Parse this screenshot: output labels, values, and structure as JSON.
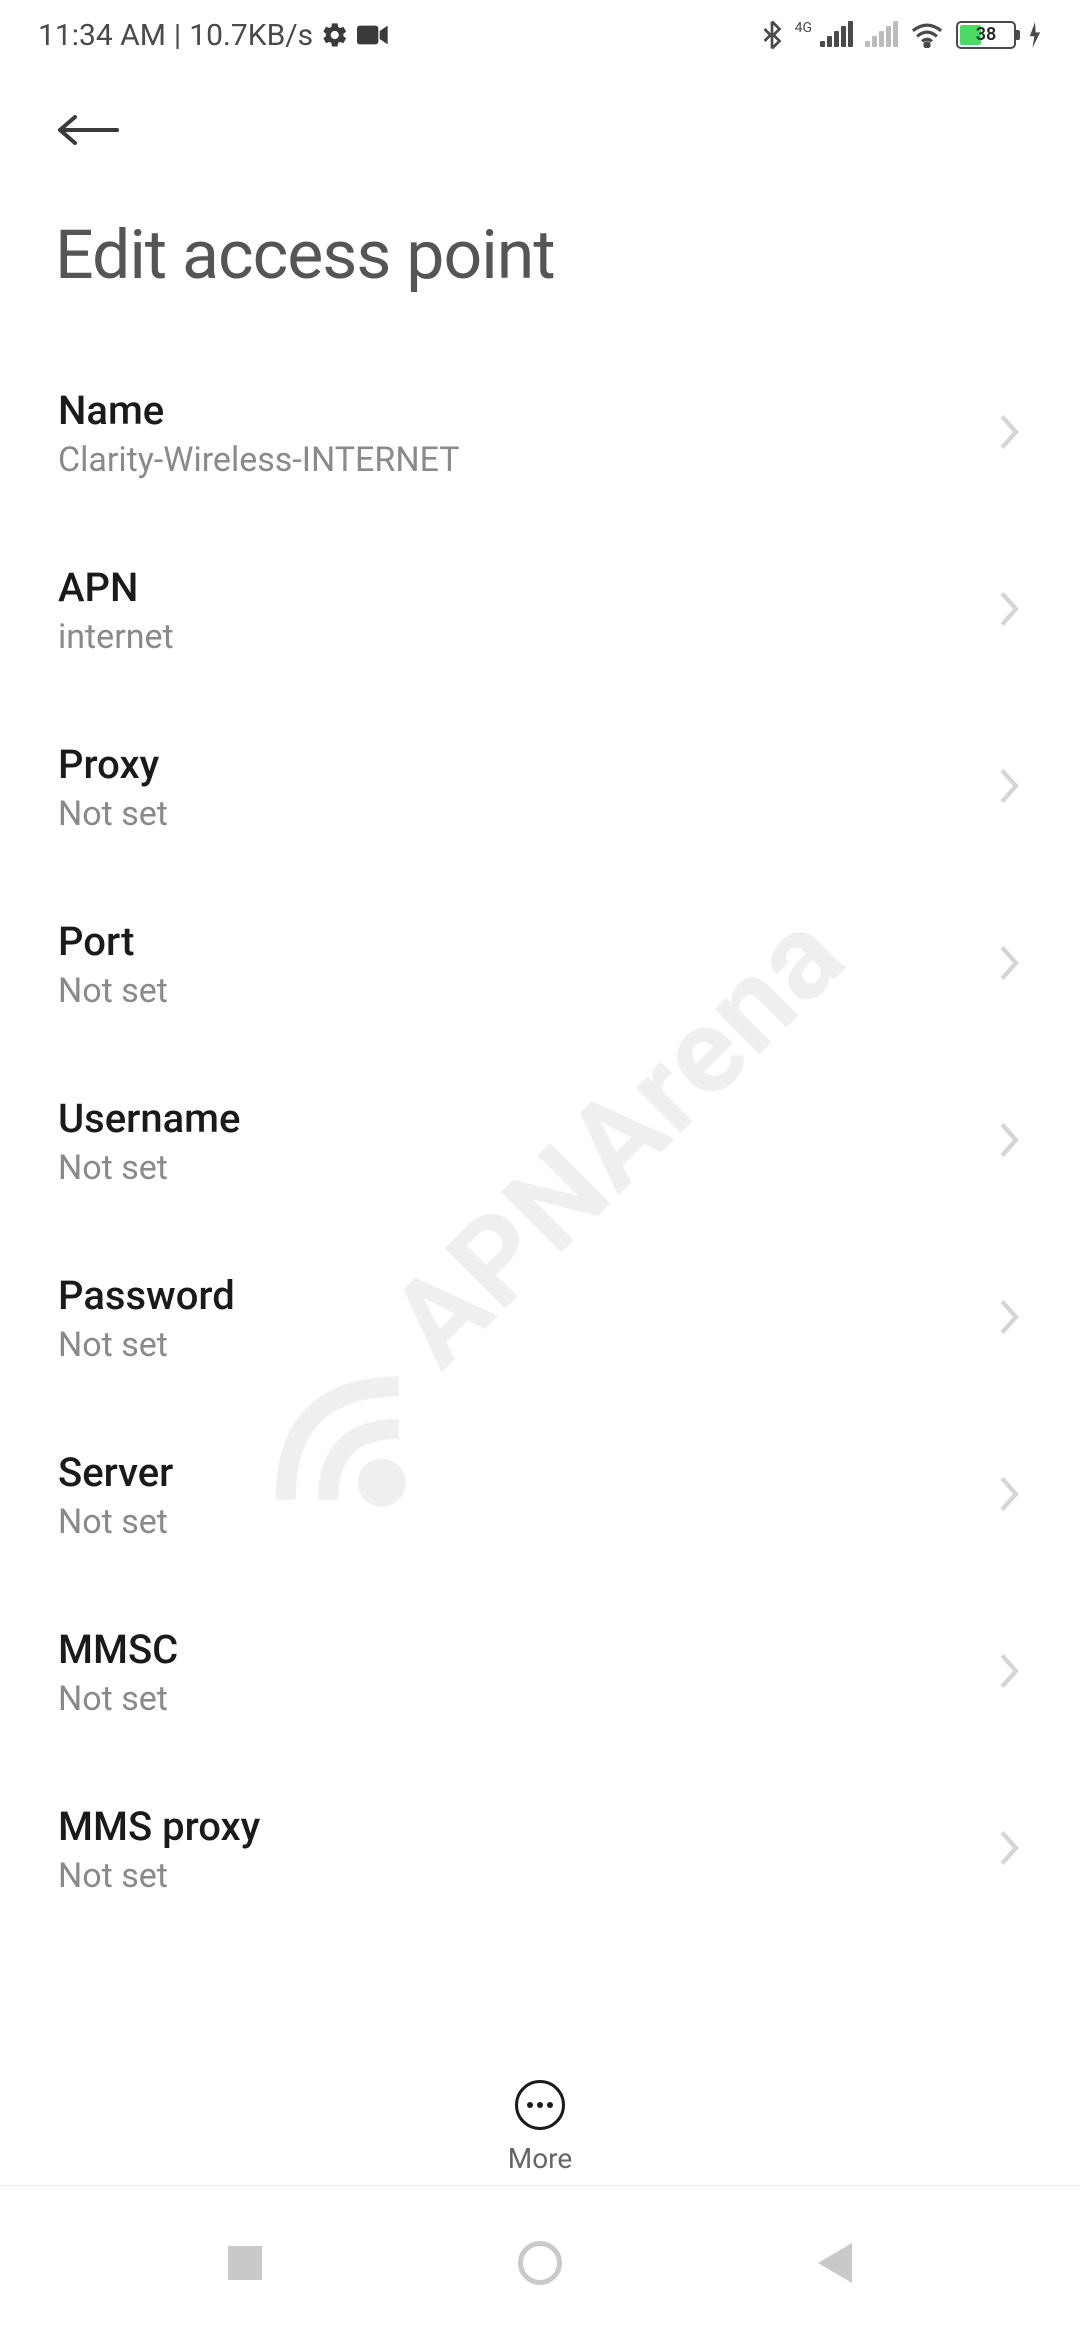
{
  "status": {
    "time": "11:34 AM",
    "network_speed": "10.7KB/s",
    "battery_percent": "38",
    "network_type": "4G"
  },
  "page": {
    "title": "Edit access point"
  },
  "items": [
    {
      "label": "Name",
      "value": "Clarity-Wireless-INTERNET"
    },
    {
      "label": "APN",
      "value": "internet"
    },
    {
      "label": "Proxy",
      "value": "Not set"
    },
    {
      "label": "Port",
      "value": "Not set"
    },
    {
      "label": "Username",
      "value": "Not set"
    },
    {
      "label": "Password",
      "value": "Not set"
    },
    {
      "label": "Server",
      "value": "Not set"
    },
    {
      "label": "MMSC",
      "value": "Not set"
    },
    {
      "label": "MMS proxy",
      "value": "Not set"
    }
  ],
  "bottom": {
    "more_label": "More"
  },
  "watermark": "APNArena"
}
